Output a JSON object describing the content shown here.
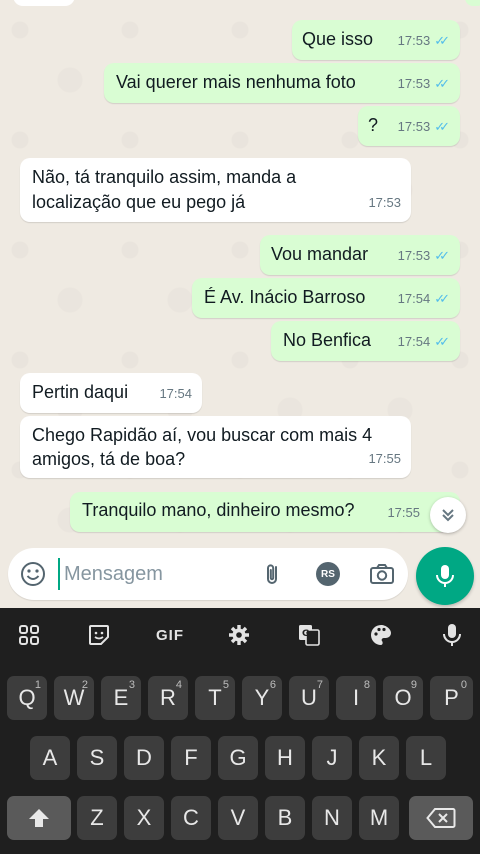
{
  "chat": {
    "messages": [
      {
        "dir": "out",
        "text": "Que isso",
        "time": "17:53"
      },
      {
        "dir": "out",
        "text": "Vai querer mais nenhuma foto",
        "time": "17:53"
      },
      {
        "dir": "out",
        "text": "?",
        "time": "17:53"
      },
      {
        "dir": "in",
        "line1": "Não, tá tranquilo assim, manda a",
        "line2": "localização que eu pego já",
        "time": "17:53"
      },
      {
        "dir": "out",
        "text": "Vou mandar",
        "time": "17:53"
      },
      {
        "dir": "out",
        "text": "É Av. Inácio Barroso",
        "time": "17:54"
      },
      {
        "dir": "out",
        "text": "No Benfica",
        "time": "17:54"
      },
      {
        "dir": "in",
        "text": "Pertin daqui",
        "time": "17:54"
      },
      {
        "dir": "in",
        "line1": "Chego Rapidão aí, vou buscar com mais 4",
        "line2": "amigos, tá de boa?",
        "time": "17:55"
      },
      {
        "dir": "out",
        "text": "Tranquilo mano, dinheiro mesmo?",
        "time": "17:55"
      }
    ],
    "read_ticks": "✓✓",
    "tick_color": "#53bdeb"
  },
  "composer": {
    "placeholder": "Mensagem",
    "rs_badge": "RS",
    "accent": "#00a884"
  },
  "keyboard": {
    "toolbar": {
      "gif": "GIF"
    },
    "row1": [
      {
        "k": "Q",
        "h": "1"
      },
      {
        "k": "W",
        "h": "2"
      },
      {
        "k": "E",
        "h": "3"
      },
      {
        "k": "R",
        "h": "4"
      },
      {
        "k": "T",
        "h": "5"
      },
      {
        "k": "Y",
        "h": "6"
      },
      {
        "k": "U",
        "h": "7"
      },
      {
        "k": "I",
        "h": "8"
      },
      {
        "k": "O",
        "h": "9"
      },
      {
        "k": "P",
        "h": "0"
      }
    ],
    "row2": [
      "A",
      "S",
      "D",
      "F",
      "G",
      "H",
      "J",
      "K",
      "L"
    ],
    "row3": [
      "Z",
      "X",
      "C",
      "V",
      "B",
      "N",
      "M"
    ]
  }
}
